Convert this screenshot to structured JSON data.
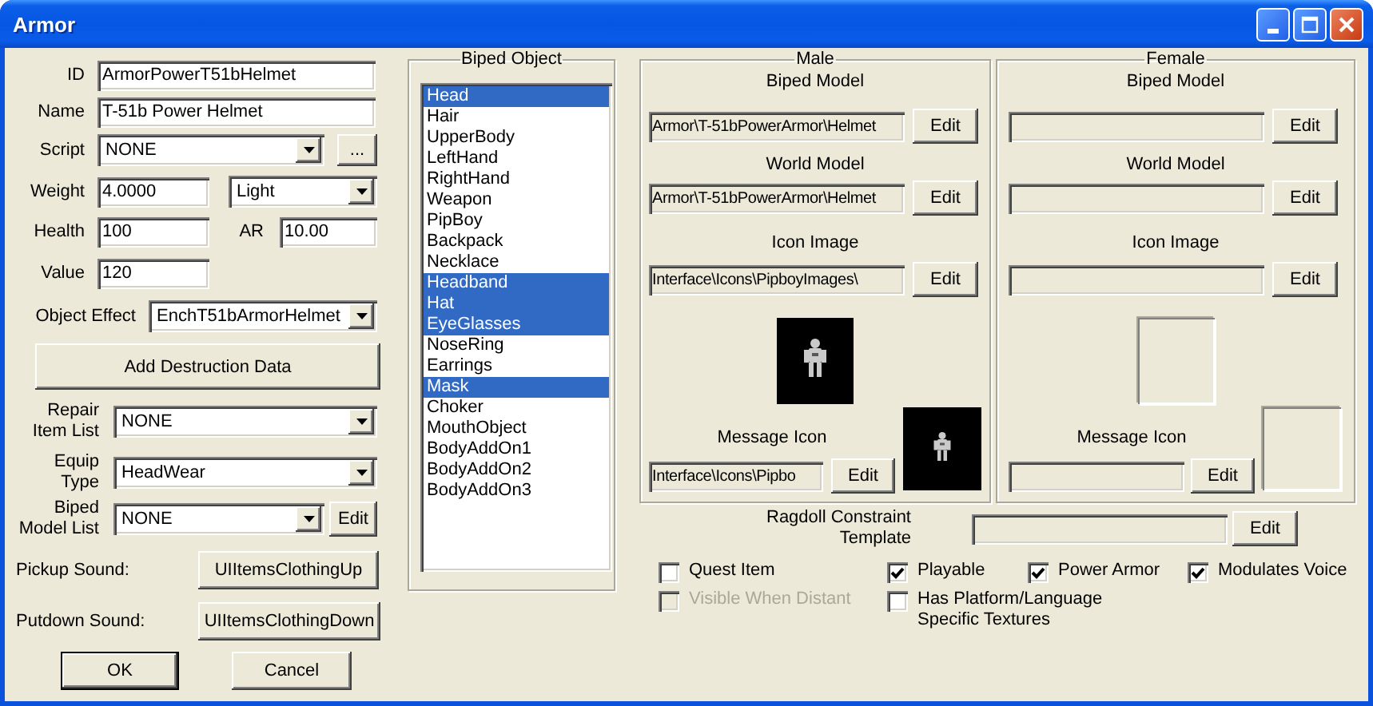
{
  "window": {
    "title": "Armor"
  },
  "id": {
    "label": "ID",
    "value": "ArmorPowerT51bHelmet"
  },
  "name": {
    "label": "Name",
    "value": "T-51b Power Helmet"
  },
  "script": {
    "label": "Script",
    "value": "NONE",
    "button": "..."
  },
  "weight": {
    "label": "Weight",
    "value": "4.0000",
    "class": "Light"
  },
  "health": {
    "label": "Health",
    "value": "100"
  },
  "ar": {
    "label": "AR",
    "value": "10.00"
  },
  "value": {
    "label": "Value",
    "value": "120"
  },
  "object_effect": {
    "label": "Object Effect",
    "value": "EnchT51bArmorHelmet"
  },
  "add_destruction_button": "Add Destruction Data",
  "repair_item_list": {
    "label": "Repair\nItem List",
    "value": "NONE"
  },
  "equip_type": {
    "label": "Equip\nType",
    "value": "HeadWear"
  },
  "biped_model_list": {
    "label": "Biped\nModel List",
    "value": "NONE",
    "button": "Edit"
  },
  "pickup_sound": {
    "label": "Pickup Sound:",
    "button": "UIItemsClothingUp"
  },
  "putdown_sound": {
    "label": "Putdown Sound:",
    "button": "UIItemsClothingDown"
  },
  "buttons": [
    {
      "label": "OK",
      "default": true
    },
    {
      "label": "Cancel",
      "default": false
    }
  ],
  "biped_object": {
    "title": "Biped Object",
    "items": [
      {
        "label": "Head",
        "selected": true
      },
      {
        "label": "Hair",
        "selected": false
      },
      {
        "label": "UpperBody",
        "selected": false
      },
      {
        "label": "LeftHand",
        "selected": false
      },
      {
        "label": "RightHand",
        "selected": false
      },
      {
        "label": "Weapon",
        "selected": false
      },
      {
        "label": "PipBoy",
        "selected": false
      },
      {
        "label": "Backpack",
        "selected": false
      },
      {
        "label": "Necklace",
        "selected": false
      },
      {
        "label": "Headband",
        "selected": true
      },
      {
        "label": "Hat",
        "selected": true
      },
      {
        "label": "EyeGlasses",
        "selected": true
      },
      {
        "label": "NoseRing",
        "selected": false
      },
      {
        "label": "Earrings",
        "selected": false
      },
      {
        "label": "Mask",
        "selected": true
      },
      {
        "label": "Choker",
        "selected": false
      },
      {
        "label": "MouthObject",
        "selected": false
      },
      {
        "label": "BodyAddOn1",
        "selected": false
      },
      {
        "label": "BodyAddOn2",
        "selected": false
      },
      {
        "label": "BodyAddOn3",
        "selected": false
      }
    ]
  },
  "male": {
    "title": "Male",
    "biped_model": {
      "label": "Biped Model",
      "value": "Armor\\T-51bPowerArmor\\Helmet",
      "button": "Edit"
    },
    "world_model": {
      "label": "World Model",
      "value": "Armor\\T-51bPowerArmor\\Helmet",
      "button": "Edit"
    },
    "icon_image": {
      "label": "Icon Image",
      "value": "Interface\\Icons\\PipboyImages\\",
      "button": "Edit"
    },
    "message_icon": {
      "label": "Message Icon",
      "value": "Interface\\Icons\\Pipbo",
      "button": "Edit"
    }
  },
  "female": {
    "title": "Female",
    "biped_model": {
      "label": "Biped Model",
      "button": "Edit"
    },
    "world_model": {
      "label": "World Model",
      "button": "Edit"
    },
    "icon_image": {
      "label": "Icon Image",
      "button": "Edit",
      "preview": {
        "kind": "empty"
      }
    },
    "message_icon": {
      "label": "Message Icon",
      "button": "Edit",
      "preview": {
        "kind": "empty"
      }
    }
  },
  "ragdoll_constraint_template": {
    "label": "Ragdoll Constraint\nTemplate",
    "button": "Edit"
  },
  "flags": [
    {
      "label": "Quest Item",
      "checked": false,
      "disabled": false
    },
    {
      "label": "Playable",
      "checked": true,
      "disabled": false
    },
    {
      "label": "Power Armor",
      "checked": true,
      "disabled": false
    },
    {
      "label": "Modulates Voice",
      "checked": true,
      "disabled": false
    },
    {
      "label": "Visible When Distant",
      "checked": false,
      "disabled": true
    },
    {
      "label": "Has Platform/Language\nSpecific Textures",
      "checked": false,
      "disabled": false
    }
  ]
}
